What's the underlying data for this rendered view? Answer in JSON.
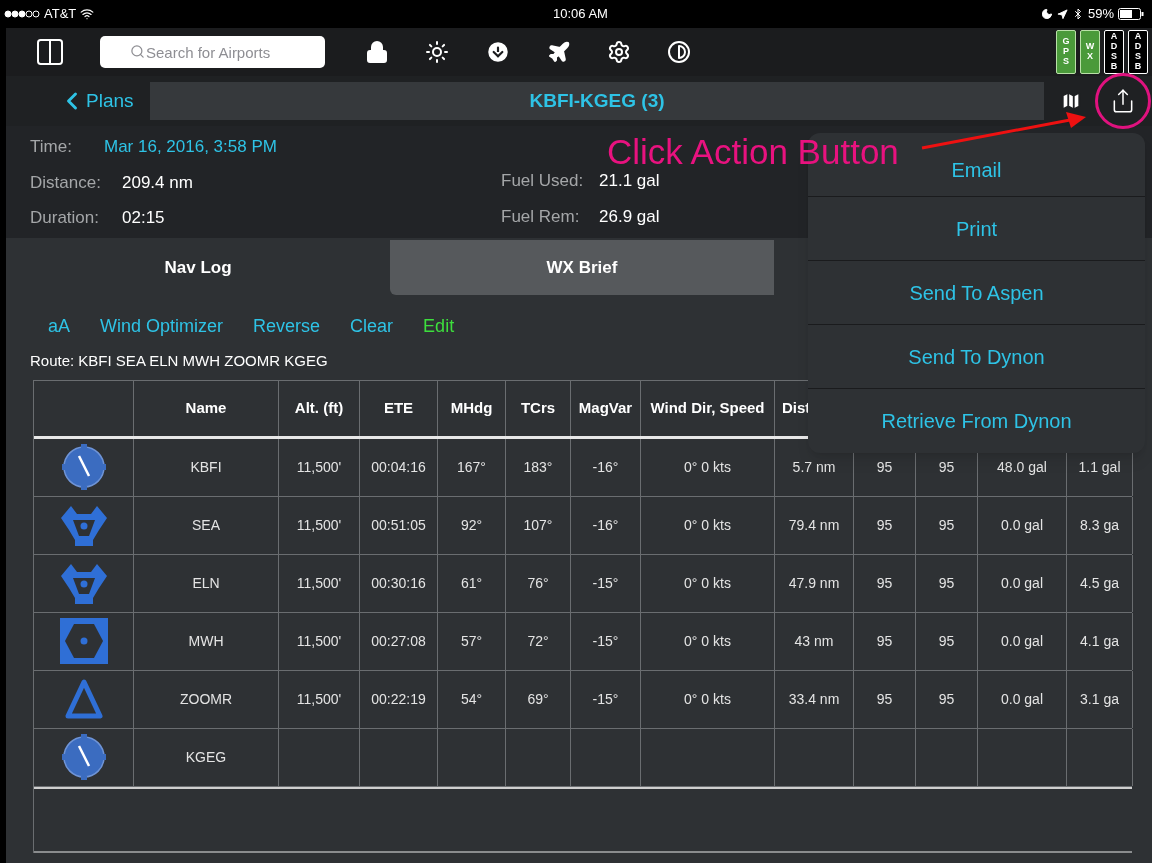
{
  "status_bar": {
    "carrier": "AT&T",
    "time": "10:06 AM",
    "battery": "59%"
  },
  "toolbar": {
    "search": {
      "placeholder": "Search for Airports"
    },
    "indicators": [
      {
        "label": "GPS",
        "on": true
      },
      {
        "label": "WX",
        "on": true
      },
      {
        "label": "ADSB",
        "on": false
      },
      {
        "label": "ADSB",
        "on": false
      }
    ]
  },
  "nav": {
    "back": "Plans",
    "title": "KBFI-KGEG (3)"
  },
  "summary": {
    "left": [
      {
        "label": "Time:",
        "value": "Mar 16, 2016, 3:58 PM",
        "kind": "link"
      },
      {
        "label": "Distance:",
        "value": "209.4 nm",
        "kind": "plain"
      },
      {
        "label": "Duration:",
        "value": "02:15",
        "kind": "plain"
      }
    ],
    "right": [
      {
        "label": "Fuel Used:",
        "value": "21.1 gal"
      },
      {
        "label": "Fuel Rem:",
        "value": "26.9 gal"
      }
    ]
  },
  "tabs": [
    {
      "label": "Nav Log",
      "selected": true
    },
    {
      "label": "WX Brief",
      "selected": false
    }
  ],
  "actions": [
    {
      "label": "aA",
      "kind": "link"
    },
    {
      "label": "Wind Optimizer",
      "kind": "link"
    },
    {
      "label": "Reverse",
      "kind": "link"
    },
    {
      "label": "Clear",
      "kind": "link"
    },
    {
      "label": "Edit",
      "kind": "edit"
    }
  ],
  "route": "Route: KBFI SEA ELN MWH ZOOMR KGEG",
  "table": {
    "columns": [
      "Name",
      "Alt. (ft)",
      "ETE",
      "MHdg",
      "TCrs",
      "MagVar",
      "Wind Dir, Speed",
      "Dist"
    ],
    "rows": [
      {
        "kind": "airport",
        "cells": [
          "KBFI",
          "11,500'",
          "00:04:16",
          "167°",
          "183°",
          "-16°",
          "0° 0 kts",
          "5.7 nm",
          "95",
          "95",
          "48.0 gal",
          "1.1 gal"
        ]
      },
      {
        "kind": "vortac",
        "cells": [
          "SEA",
          "11,500'",
          "00:51:05",
          "92°",
          "107°",
          "-16°",
          "0° 0 kts",
          "79.4 nm",
          "95",
          "95",
          "0.0 gal",
          "8.3 ga"
        ]
      },
      {
        "kind": "vortac",
        "cells": [
          "ELN",
          "11,500'",
          "00:30:16",
          "61°",
          "76°",
          "-15°",
          "0° 0 kts",
          "47.9 nm",
          "95",
          "95",
          "0.0 gal",
          "4.5 ga"
        ]
      },
      {
        "kind": "vordme",
        "cells": [
          "MWH",
          "11,500'",
          "00:27:08",
          "57°",
          "72°",
          "-15°",
          "0° 0 kts",
          "43 nm",
          "95",
          "95",
          "0.0 gal",
          "4.1 ga"
        ]
      },
      {
        "kind": "fix",
        "cells": [
          "ZOOMR",
          "11,500'",
          "00:22:19",
          "54°",
          "69°",
          "-15°",
          "0° 0 kts",
          "33.4 nm",
          "95",
          "95",
          "0.0 gal",
          "3.1 ga"
        ]
      },
      {
        "kind": "airport",
        "cells": [
          "KGEG"
        ]
      }
    ]
  },
  "popover": {
    "items": [
      "Email",
      "Print",
      "Send To Aspen",
      "Send To Dynon",
      "Retrieve From Dynon"
    ]
  },
  "annotation": {
    "text": "Click Action Button"
  }
}
